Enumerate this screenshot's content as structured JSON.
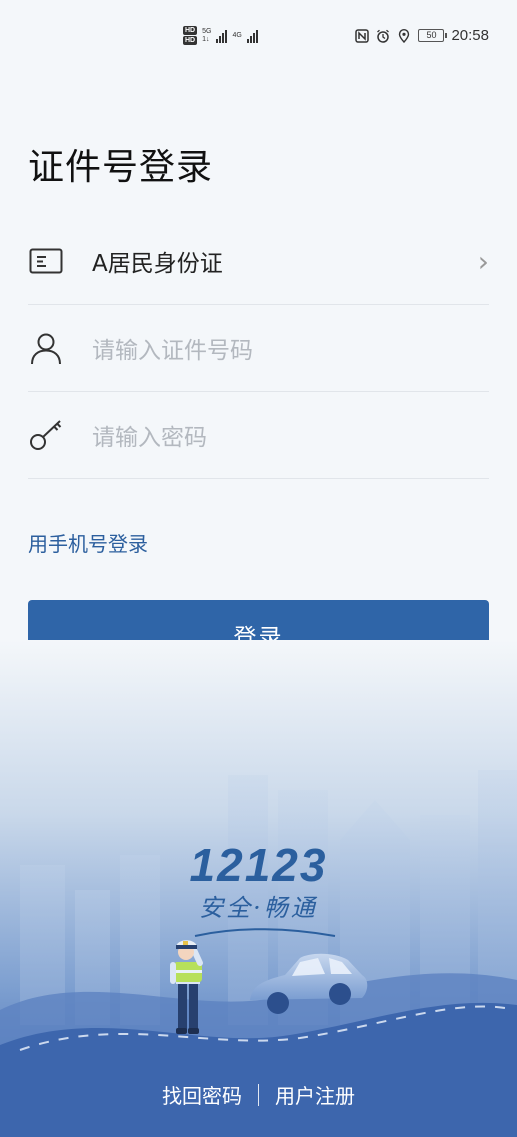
{
  "status_bar": {
    "hd1": "HD",
    "hd2": "HD",
    "net1_top": "5G",
    "net1_bottom": "1↓",
    "net2": "4G",
    "battery": "50",
    "time": "20:58",
    "icons": [
      "nfc-icon",
      "alarm-icon",
      "location-icon",
      "battery-icon"
    ]
  },
  "page": {
    "title": "证件号登录"
  },
  "form": {
    "id_type": {
      "icon": "id-card-icon",
      "value": "A居民身份证",
      "chevron": "›"
    },
    "id_number": {
      "icon": "user-icon",
      "placeholder": "请输入证件号码"
    },
    "password": {
      "icon": "key-icon",
      "placeholder": "请输入密码"
    }
  },
  "alt_login_label": "用手机号登录",
  "login_button_label": "登录",
  "branding": {
    "number": "12123",
    "slogan": "安全·畅通"
  },
  "footer": {
    "recover_password": "找回密码",
    "register": "用户注册"
  },
  "colors": {
    "primary": "#2f65a8",
    "link": "#2c5f9e",
    "background": "#f4f7fa"
  }
}
